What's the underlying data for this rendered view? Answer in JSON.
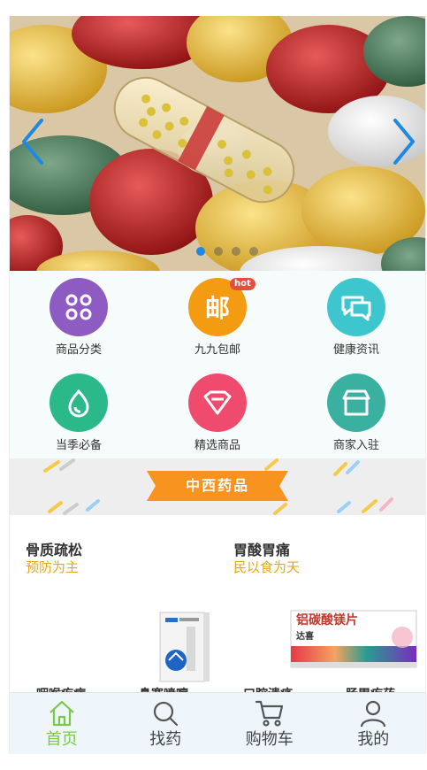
{
  "banner": {
    "slide_count": 4,
    "active_slide": 1
  },
  "quick_nav": [
    {
      "label": "商品分类",
      "icon": "grid-icon",
      "color": "#8e5bc3"
    },
    {
      "label": "九九包邮",
      "icon": "mail-char-icon",
      "color": "#f39c12",
      "badge": "hot",
      "glyph": "邮"
    },
    {
      "label": "健康资讯",
      "icon": "chat-icon",
      "color": "#3ec6cf"
    },
    {
      "label": "当季必备",
      "icon": "drop-icon",
      "color": "#2bb98a"
    },
    {
      "label": "精选商品",
      "icon": "diamond-icon",
      "color": "#ef4b6f"
    },
    {
      "label": "商家入驻",
      "icon": "store-icon",
      "color": "#3ab0a0"
    }
  ],
  "section": {
    "title": "中西药品",
    "accent": "#f7931e"
  },
  "products": [
    {
      "title": "骨质疏松",
      "subtitle": "预防为主"
    },
    {
      "title": "胃酸胃痛",
      "subtitle": "民以食为天",
      "pack_label": "铝碳酸镁片",
      "brand": "达喜"
    }
  ],
  "more_categories": [
    "咽喉疾病",
    "鼻塞喷嚏",
    "口腔溃疡",
    "肠胃疾药"
  ],
  "tabbar": [
    {
      "label": "首页",
      "icon": "home-icon",
      "active": true
    },
    {
      "label": "找药",
      "icon": "search-icon",
      "active": false
    },
    {
      "label": "购物车",
      "icon": "cart-icon",
      "active": false
    },
    {
      "label": "我的",
      "icon": "user-icon",
      "active": false
    }
  ],
  "colors": {
    "active_tab": "#7ac943",
    "dot_active": "#1e88e5",
    "subtitle": "#e6a817"
  }
}
